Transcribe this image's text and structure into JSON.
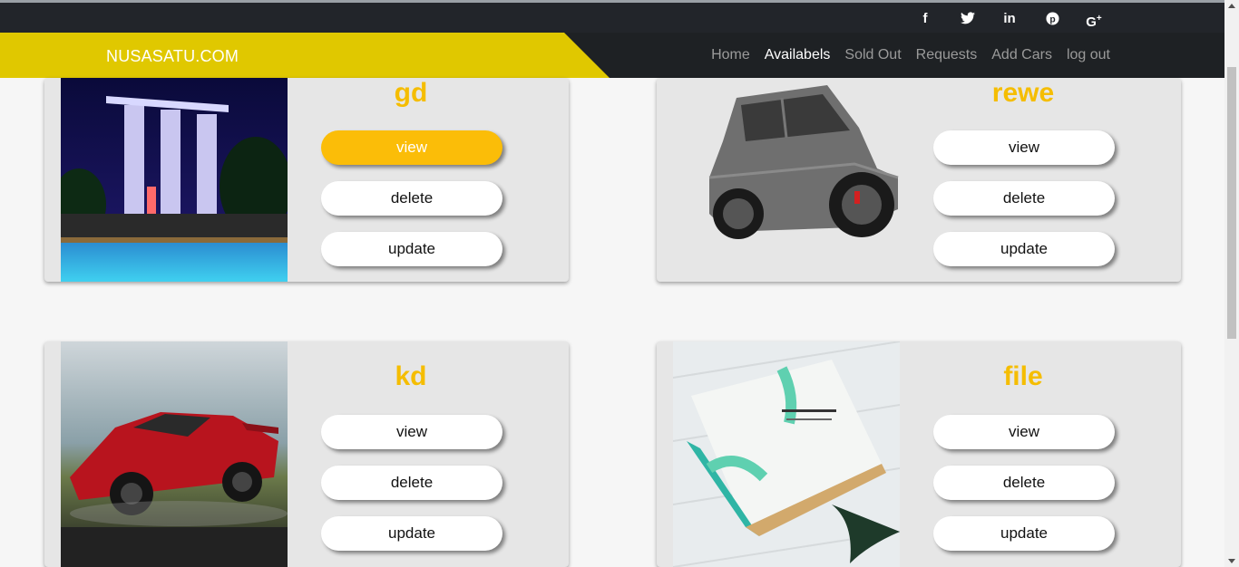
{
  "topbar": {
    "social_icons": [
      {
        "name": "facebook-icon",
        "glyph": "f"
      },
      {
        "name": "twitter-icon",
        "glyph": "🐦"
      },
      {
        "name": "linkedin-icon",
        "glyph": "in"
      },
      {
        "name": "pinterest-icon",
        "glyph": "ⓟ"
      },
      {
        "name": "google-plus-icon",
        "glyph": "G+"
      }
    ]
  },
  "navbar": {
    "brand": "NUSASATU.COM",
    "links": [
      "Home",
      "Availabels",
      "Sold Out",
      "Requests",
      "Add Cars",
      "log out"
    ],
    "active": "Availabels"
  },
  "buttons": {
    "view": "view",
    "delete": "delete",
    "update": "update"
  },
  "cards": [
    {
      "title": "gd",
      "image": "night-resort-photo",
      "view_highlighted": true
    },
    {
      "title": "rewe",
      "image": "grey-suv-photo",
      "view_highlighted": false
    },
    {
      "title": "kd",
      "image": "red-sports-car-photo",
      "view_highlighted": false
    },
    {
      "title": "file",
      "image": "book-photo",
      "view_highlighted": false
    }
  ],
  "colors": {
    "brand_yellow": "#e0c800",
    "title_yellow": "#f5bd00",
    "button_highlight": "#fbbd08",
    "navbar_dark": "#1e2124"
  }
}
